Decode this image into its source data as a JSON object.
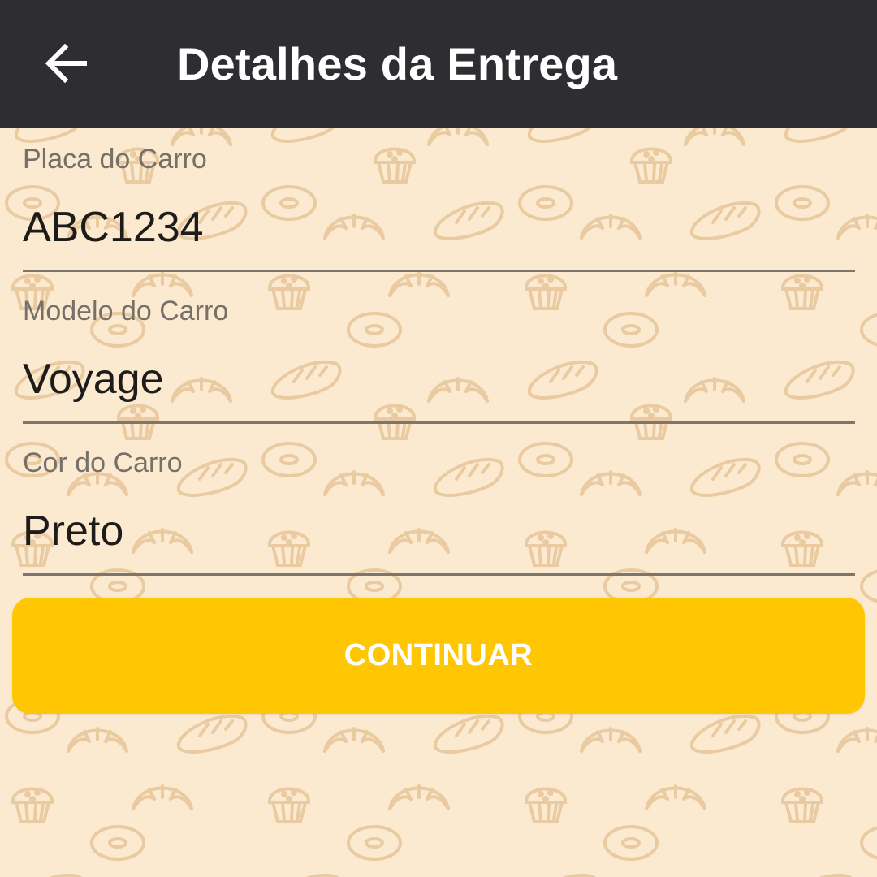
{
  "app_bar": {
    "back_icon": "arrow-left-icon",
    "title": "Detalhes da Entrega"
  },
  "form": {
    "fields": [
      {
        "label": "Placa do Carro",
        "value": "ABC1234"
      },
      {
        "label": "Modelo do Carro",
        "value": "Voyage"
      },
      {
        "label": "Cor do Carro",
        "value": "Preto"
      }
    ]
  },
  "actions": {
    "continue_label": "CONTINUAR"
  },
  "colors": {
    "app_bar": "#2e2d31",
    "background": "#fbe9d0",
    "accent": "#fec603",
    "pattern": "#e9c99b"
  }
}
